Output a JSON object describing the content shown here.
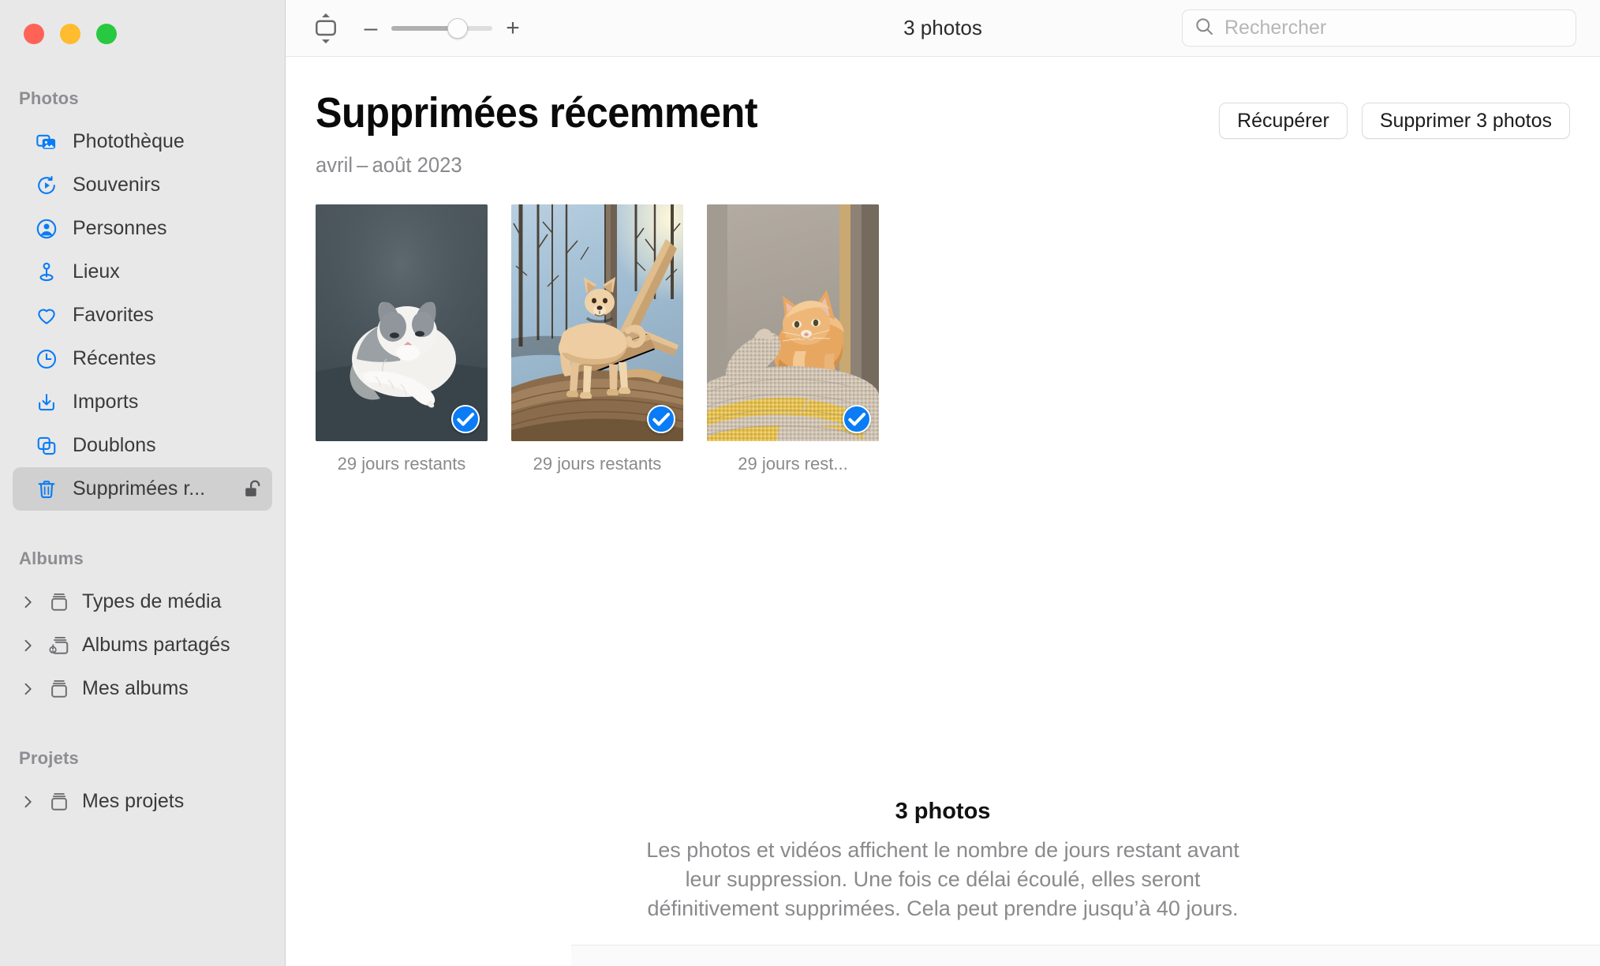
{
  "window": {
    "controls": [
      {
        "name": "close",
        "color": "#ff6257"
      },
      {
        "name": "minimize",
        "color": "#febc2e"
      },
      {
        "name": "zoom",
        "color": "#28c840"
      }
    ]
  },
  "toolbar": {
    "zoom_stepper_icon": "aspect-stepper-icon",
    "zoom_out_label": "–",
    "zoom_in_label": "+",
    "zoom_slider_value": 66,
    "photo_count": "3 photos",
    "search": {
      "icon": "search-icon",
      "placeholder": "Rechercher",
      "value": ""
    }
  },
  "sidebar": {
    "sections": [
      {
        "label": "Photos",
        "items": [
          {
            "label": "Photothèque",
            "icon": "photo-library-icon",
            "selected": false
          },
          {
            "label": "Souvenirs",
            "icon": "memories-play-icon",
            "selected": false
          },
          {
            "label": "Personnes",
            "icon": "person-circle-icon",
            "selected": false
          },
          {
            "label": "Lieux",
            "icon": "map-pin-icon",
            "selected": false
          },
          {
            "label": "Favorites",
            "icon": "heart-icon",
            "selected": false
          },
          {
            "label": "Récentes",
            "icon": "clock-icon",
            "selected": false
          },
          {
            "label": "Imports",
            "icon": "import-download-icon",
            "selected": false
          },
          {
            "label": "Doublons",
            "icon": "duplicates-icon",
            "selected": false
          },
          {
            "label": "Supprimées r...",
            "icon": "trash-icon",
            "selected": true,
            "trailing_icon": "unlocked-padlock-icon"
          }
        ]
      },
      {
        "label": "Albums",
        "items": [
          {
            "label": "Types de média",
            "icon": "album-stack-icon",
            "chevron": "chevron-right-icon"
          },
          {
            "label": "Albums partagés",
            "icon": "shared-album-icon",
            "chevron": "chevron-right-icon"
          },
          {
            "label": "Mes albums",
            "icon": "album-stack-icon",
            "chevron": "chevron-right-icon"
          }
        ]
      },
      {
        "label": "Projets",
        "items": [
          {
            "label": "Mes projets",
            "icon": "album-stack-icon",
            "chevron": "chevron-right-icon"
          }
        ]
      }
    ]
  },
  "main": {
    "title": "Supprimées récemment",
    "subtitle": "avril – août 2023",
    "buttons": {
      "recover": "Récupérer",
      "delete": "Supprimer 3 photos"
    },
    "photos": [
      {
        "caption": "29 jours restants",
        "selected": true,
        "subject": "grey-and-white-cat-on-dark-couch"
      },
      {
        "caption": "29 jours restants",
        "selected": true,
        "subject": "tan-dog-on-fallen-log-in-forest"
      },
      {
        "caption": "29 jours rest...",
        "selected": true,
        "subject": "orange-kitten-on-woven-basket"
      }
    ],
    "footer": {
      "count": "3 photos",
      "description": "Les photos et vidéos affichent le nombre de jours restant avant leur suppression. Une fois ce délai écoulé, elles seront définitivement supprimées. Cela peut prendre jusqu’à 40 jours."
    }
  },
  "colors": {
    "accent": "#0a7cf5",
    "sidebar_bg": "#e8e8e8",
    "selected_row": "#d0d0d0",
    "muted_text": "#8a8a8e"
  }
}
